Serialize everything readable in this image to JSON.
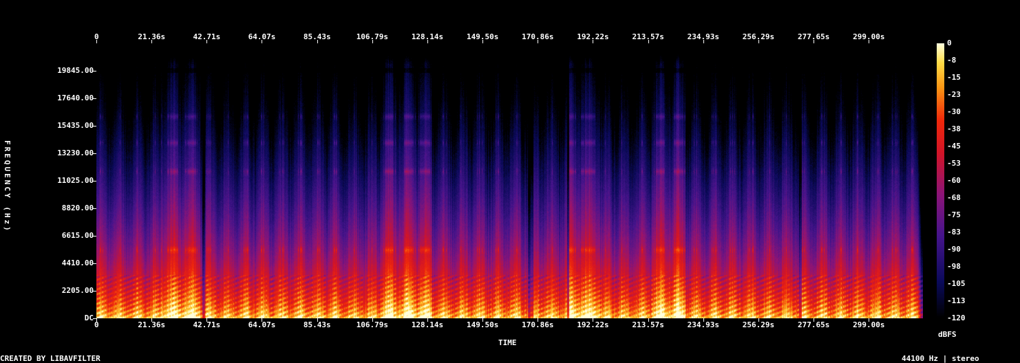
{
  "chart_data": {
    "type": "heatmap",
    "title": "",
    "xlabel": "TIME",
    "ylabel": "FREQUENCY (Hz)",
    "x_ticks": [
      "0",
      "21.36s",
      "42.71s",
      "64.07s",
      "85.43s",
      "106.79s",
      "128.14s",
      "149.50s",
      "170.86s",
      "192.22s",
      "213.57s",
      "234.93s",
      "256.29s",
      "277.65s",
      "299.00s"
    ],
    "x_tick_values": [
      0,
      21.36,
      42.71,
      64.07,
      85.43,
      106.79,
      128.14,
      149.5,
      170.86,
      192.22,
      213.57,
      234.93,
      256.29,
      277.65,
      299.0
    ],
    "xlim": [
      0,
      320
    ],
    "y_ticks": [
      "DC",
      "2205.00",
      "4410.00",
      "6615.00",
      "8820.00",
      "11025.00",
      "13230.00",
      "15435.00",
      "17640.00",
      "19845.00"
    ],
    "y_tick_values": [
      0,
      2205,
      4410,
      6615,
      8820,
      11025,
      13230,
      15435,
      17640,
      19845
    ],
    "ylim": [
      0,
      22050
    ],
    "colorbar": {
      "label": "dBFS",
      "ticks": [
        "0",
        "-8",
        "-15",
        "-23",
        "-30",
        "-38",
        "-45",
        "-53",
        "-60",
        "-68",
        "-75",
        "-83",
        "-90",
        "-98",
        "-105",
        "-113",
        "-120"
      ],
      "range": [
        -120,
        0
      ]
    },
    "louder_sections_s": [
      [
        25,
        40
      ],
      [
        110,
        130
      ],
      [
        183,
        195
      ],
      [
        215,
        228
      ]
    ],
    "quiet_gaps_s": [
      [
        41,
        42
      ],
      [
        167,
        169
      ],
      [
        182,
        183
      ],
      [
        272,
        273
      ]
    ],
    "harmonic_bands_hz": [
      5500,
      11800,
      14100,
      16200
    ]
  },
  "footer": {
    "left": "CREATED BY LIBAVFILTER",
    "right": "44100 Hz | stereo"
  },
  "colors": {
    "background": "#000000",
    "text": "#ffffff"
  }
}
